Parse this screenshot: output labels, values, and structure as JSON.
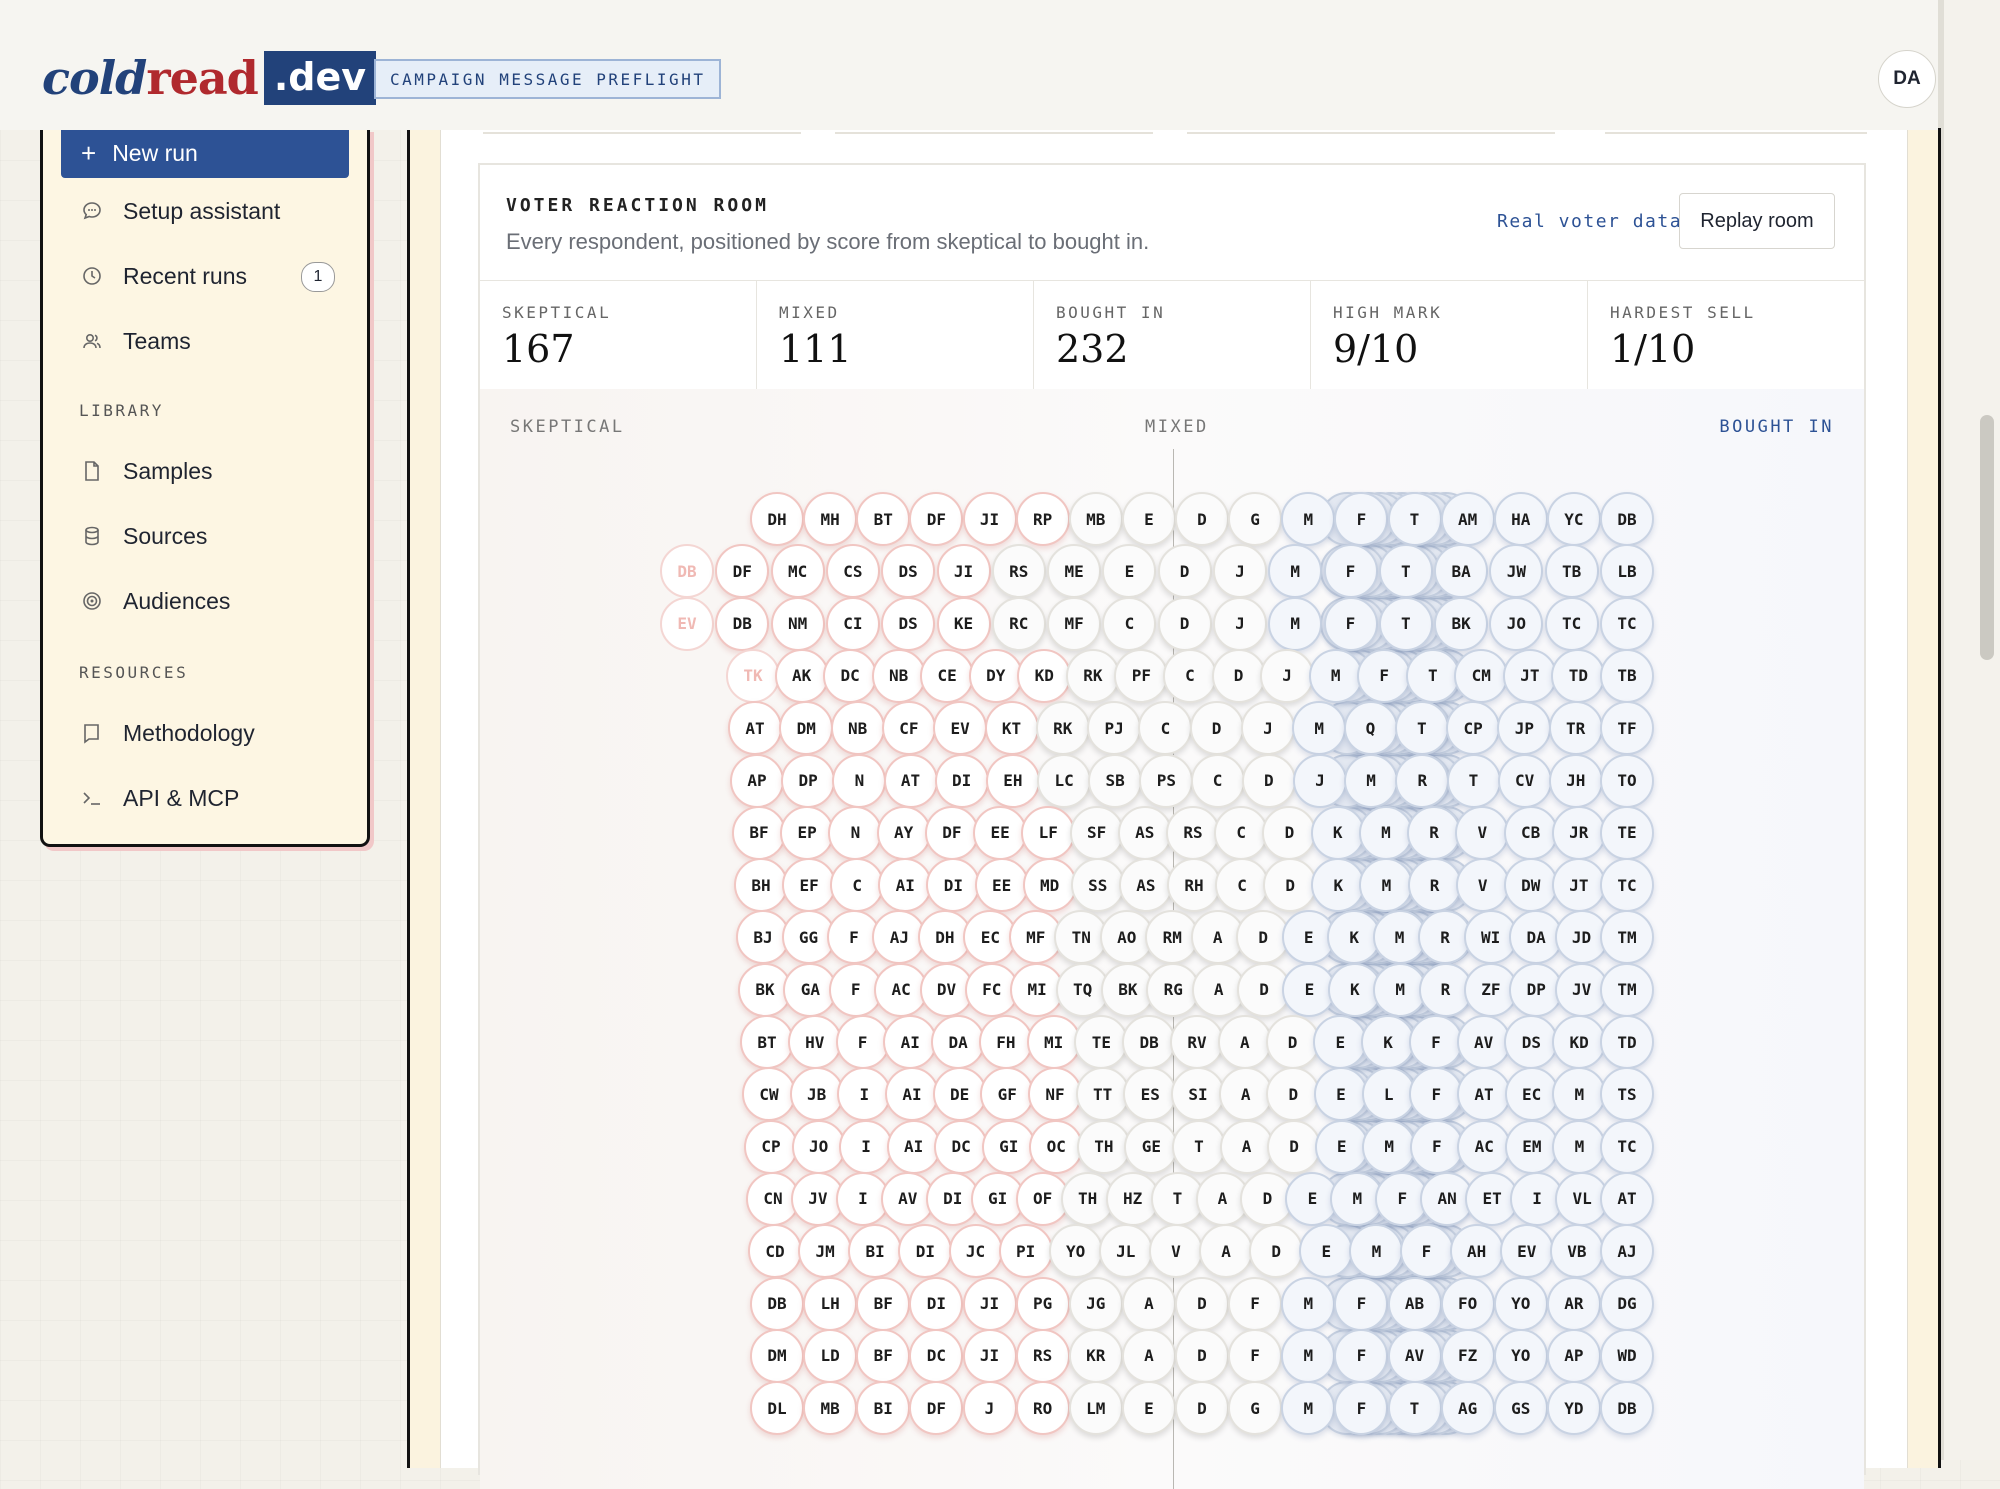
{
  "header": {
    "logo_cold": "cold",
    "logo_read": "read",
    "logo_dev": ".dev",
    "badge": "CAMPAIGN MESSAGE PREFLIGHT",
    "avatar": "DA"
  },
  "sidebar": {
    "new_run": "New run",
    "items": [
      {
        "label": "Setup assistant",
        "icon": "chat-bubble-icon"
      },
      {
        "label": "Recent runs",
        "icon": "clock-icon",
        "count": "1"
      },
      {
        "label": "Teams",
        "icon": "users-icon"
      }
    ],
    "library_label": "LIBRARY",
    "library": [
      {
        "label": "Samples",
        "icon": "file-icon"
      },
      {
        "label": "Sources",
        "icon": "database-icon"
      },
      {
        "label": "Audiences",
        "icon": "target-icon"
      }
    ],
    "resources_label": "RESOURCES",
    "resources": [
      {
        "label": "Methodology",
        "icon": "book-icon"
      },
      {
        "label": "API & MCP",
        "icon": "terminal-icon"
      }
    ]
  },
  "room": {
    "title": "VOTER REACTION ROOM",
    "subtitle": "Every respondent, positioned by score from skeptical to bought in.",
    "real_data": "Real voter data",
    "replay": "Replay room",
    "stats": [
      {
        "label": "SKEPTICAL",
        "value": "167"
      },
      {
        "label": "MIXED",
        "value": "111"
      },
      {
        "label": "BOUGHT IN",
        "value": "232"
      },
      {
        "label": "HIGH MARK",
        "value": "9/10"
      },
      {
        "label": "HARDEST SELL",
        "value": "1/10"
      }
    ],
    "axis_left": "SKEPTICAL",
    "axis_mid": "MIXED",
    "axis_right": "BOUGHT IN"
  },
  "colors": {
    "brand_blue": "#2d5295",
    "brand_red": "#b0292e",
    "skeptical_border": "#f1c6c2",
    "bought_in_border": "#c9d3e3"
  },
  "respondents": {
    "rows": [
      [
        "DH",
        "MH",
        "BT",
        "DF",
        "JI",
        "RP",
        "MB",
        "E",
        "D",
        "G",
        "M",
        "F",
        "T",
        "AM",
        "HA",
        "YC",
        "DB"
      ],
      [
        "DB",
        "DF",
        "MC",
        "CS",
        "DS",
        "JI",
        "RS",
        "ME",
        "E",
        "D",
        "J",
        "M",
        "F",
        "T",
        "BA",
        "JW",
        "TB",
        "LB"
      ],
      [
        "EV",
        "DB",
        "NM",
        "CI",
        "DS",
        "KE",
        "RC",
        "MF",
        "C",
        "D",
        "J",
        "M",
        "F",
        "T",
        "BK",
        "JO",
        "TC",
        "TC"
      ],
      [
        "TK",
        "AK",
        "DC",
        "NB",
        "CE",
        "DY",
        "KD",
        "RK",
        "PF",
        "C",
        "D",
        "J",
        "M",
        "F",
        "T",
        "CM",
        "JT",
        "TD",
        "TB"
      ],
      [
        "AT",
        "DM",
        "NB",
        "CF",
        "EV",
        "KT",
        "RK",
        "PJ",
        "C",
        "D",
        "J",
        "M",
        "Q",
        "T",
        "CP",
        "JP",
        "TR",
        "TF"
      ],
      [
        "AP",
        "DP",
        "N",
        "AT",
        "DI",
        "EH",
        "LC",
        "SB",
        "PS",
        "C",
        "D",
        "J",
        "M",
        "R",
        "T",
        "CV",
        "JH",
        "TO"
      ],
      [
        "BF",
        "EP",
        "N",
        "AY",
        "DF",
        "EE",
        "LF",
        "SF",
        "AS",
        "RS",
        "C",
        "D",
        "K",
        "M",
        "R",
        "V",
        "CB",
        "JR",
        "TE"
      ],
      [
        "BH",
        "EF",
        "C",
        "AI",
        "DI",
        "EE",
        "MD",
        "SS",
        "AS",
        "RH",
        "C",
        "D",
        "K",
        "M",
        "R",
        "V",
        "DW",
        "JT",
        "TC"
      ],
      [
        "BJ",
        "GG",
        "F",
        "AJ",
        "DH",
        "EC",
        "MF",
        "TN",
        "AO",
        "RM",
        "A",
        "D",
        "E",
        "K",
        "M",
        "R",
        "WI",
        "DA",
        "JD",
        "TM"
      ],
      [
        "BK",
        "GA",
        "F",
        "AC",
        "DV",
        "FC",
        "MI",
        "TQ",
        "BK",
        "RG",
        "A",
        "D",
        "E",
        "K",
        "M",
        "R",
        "ZF",
        "DP",
        "JV",
        "TM"
      ],
      [
        "BT",
        "HV",
        "F",
        "AI",
        "DA",
        "FH",
        "MI",
        "TE",
        "DB",
        "RV",
        "A",
        "D",
        "E",
        "K",
        "F",
        "AV",
        "DS",
        "KD",
        "TD"
      ],
      [
        "CW",
        "JB",
        "I",
        "AI",
        "DE",
        "GF",
        "NF",
        "TT",
        "ES",
        "SI",
        "A",
        "D",
        "E",
        "L",
        "F",
        "AT",
        "EC",
        "M",
        "TS"
      ],
      [
        "CP",
        "JO",
        "I",
        "AI",
        "DC",
        "GI",
        "OC",
        "TH",
        "GE",
        "T",
        "A",
        "D",
        "E",
        "M",
        "F",
        "AC",
        "EM",
        "M",
        "TC"
      ],
      [
        "CN",
        "JV",
        "I",
        "AV",
        "DI",
        "GI",
        "OF",
        "TH",
        "HZ",
        "T",
        "A",
        "D",
        "E",
        "M",
        "F",
        "AN",
        "ET",
        "I",
        "VL",
        "AT"
      ],
      [
        "CD",
        "JM",
        "BI",
        "DI",
        "JC",
        "PI",
        "YO",
        "JL",
        "V",
        "A",
        "D",
        "E",
        "M",
        "F",
        "AH",
        "EV",
        "VB",
        "AJ"
      ],
      [
        "DB",
        "LH",
        "BF",
        "DI",
        "JI",
        "PG",
        "JG",
        "A",
        "D",
        "F",
        "M",
        "F",
        "AB",
        "FO",
        "YO",
        "AR",
        "DG"
      ],
      [
        "DM",
        "LD",
        "BF",
        "DC",
        "JI",
        "RS",
        "KR",
        "A",
        "D",
        "F",
        "M",
        "F",
        "AV",
        "FZ",
        "YO",
        "AP",
        "WD"
      ],
      [
        "DL",
        "MB",
        "BI",
        "DF",
        "J",
        "RO",
        "LM",
        "E",
        "D",
        "G",
        "M",
        "F",
        "T",
        "AG",
        "GS",
        "YD",
        "DB"
      ]
    ]
  }
}
